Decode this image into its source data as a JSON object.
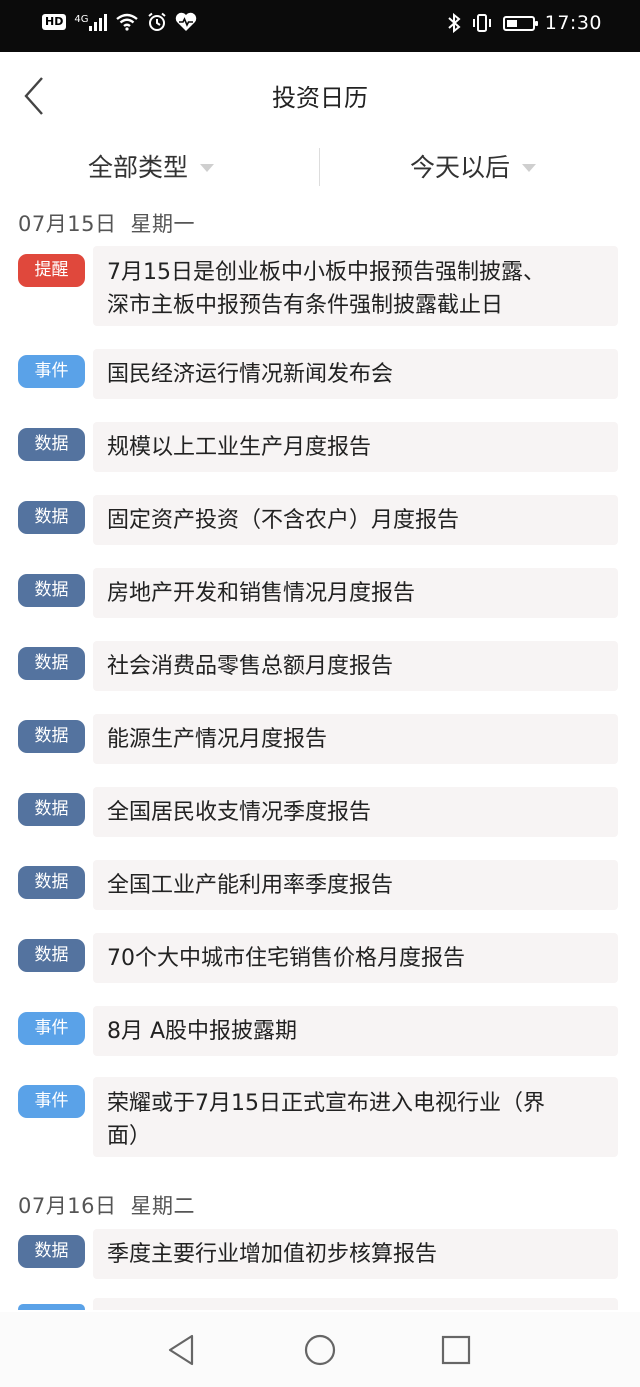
{
  "status_bar": {
    "hd": "HD",
    "network": "4G",
    "time": "17:30"
  },
  "header": {
    "title": "投资日历",
    "back_icon": "chevron-left-icon"
  },
  "filters": {
    "type_label": "全部类型",
    "range_label": "今天以后"
  },
  "tags": {
    "remind": "提醒",
    "event": "事件",
    "data": "数据"
  },
  "colors": {
    "remind": "#e0483c",
    "event": "#5aa2e8",
    "data": "#54739f",
    "card_bg": "#f7f4f4"
  },
  "sections": [
    {
      "date": "07月15日",
      "weekday": "星期一",
      "items": [
        {
          "tag": "提醒",
          "type": "remind",
          "lines": [
            "7月15日是创业板中小板中报预告强制披露、",
            "深市主板中报预告有条件强制披露截止日"
          ]
        },
        {
          "tag": "事件",
          "type": "event",
          "lines": [
            "国民经济运行情况新闻发布会"
          ]
        },
        {
          "tag": "数据",
          "type": "data",
          "lines": [
            "规模以上工业生产月度报告"
          ]
        },
        {
          "tag": "数据",
          "type": "data",
          "lines": [
            "固定资产投资（不含农户）月度报告"
          ]
        },
        {
          "tag": "数据",
          "type": "data",
          "lines": [
            "房地产开发和销售情况月度报告"
          ]
        },
        {
          "tag": "数据",
          "type": "data",
          "lines": [
            "社会消费品零售总额月度报告"
          ]
        },
        {
          "tag": "数据",
          "type": "data",
          "lines": [
            "能源生产情况月度报告"
          ]
        },
        {
          "tag": "数据",
          "type": "data",
          "lines": [
            "全国居民收支情况季度报告"
          ]
        },
        {
          "tag": "数据",
          "type": "data",
          "lines": [
            "全国工业产能利用率季度报告"
          ]
        },
        {
          "tag": "数据",
          "type": "data",
          "lines": [
            "70个大中城市住宅销售价格月度报告"
          ]
        },
        {
          "tag": "事件",
          "type": "event",
          "lines": [
            "8月 A股中报披露期"
          ]
        },
        {
          "tag": "事件",
          "type": "event",
          "lines": [
            "荣耀或于7月15日正式宣布进入电视行业（界",
            "面）"
          ]
        }
      ]
    },
    {
      "date": "07月16日",
      "weekday": "星期二",
      "items": [
        {
          "tag": "数据",
          "type": "data",
          "lines": [
            "季度主要行业增加值初步核算报告"
          ]
        }
      ]
    }
  ],
  "nav": {
    "back_icon": "triangle-back-icon",
    "home_icon": "circle-home-icon",
    "recents_icon": "square-recents-icon"
  }
}
